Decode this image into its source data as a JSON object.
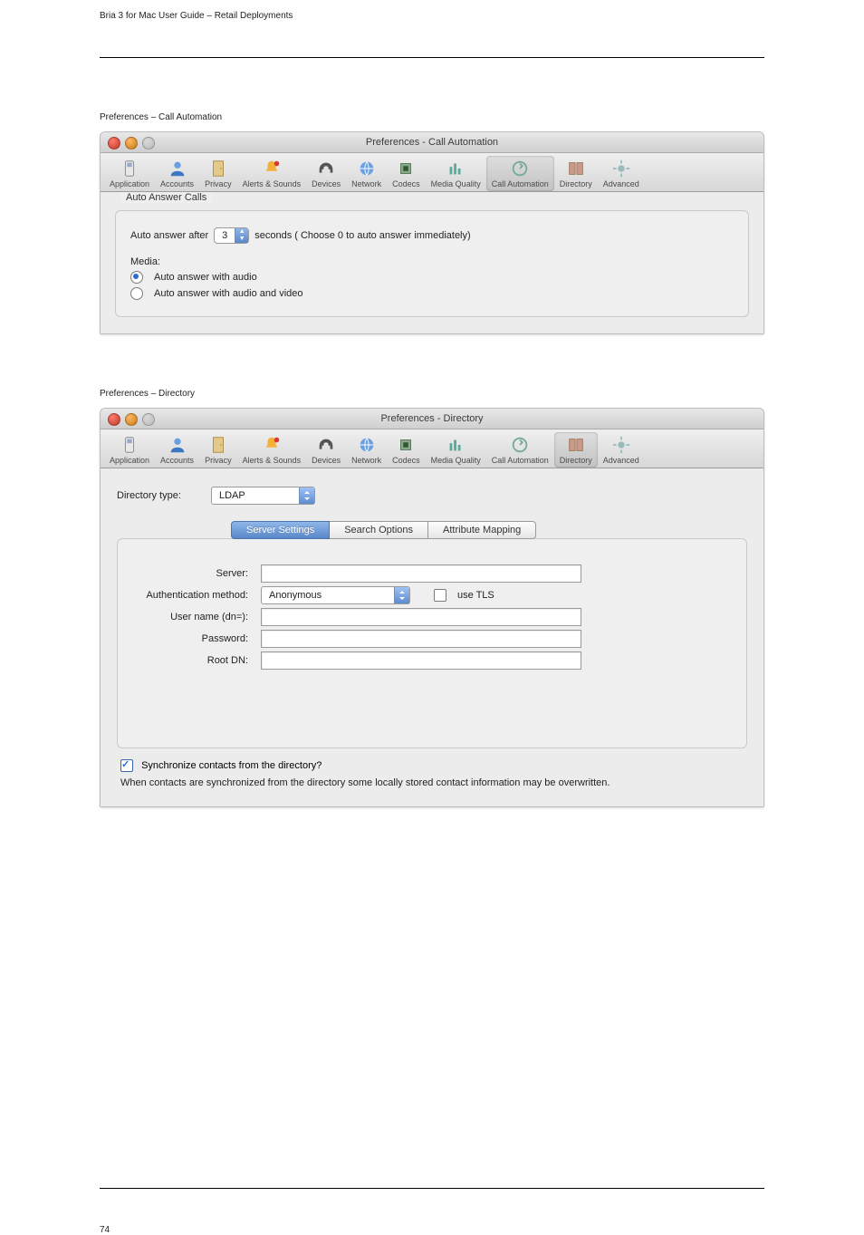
{
  "header": {
    "left": "Bria 3 for Mac User Guide – Retail Deployments"
  },
  "sections": {
    "call_automation_title": "Preferences – Call Automation",
    "directory_heading": "Preferences – Directory"
  },
  "toolbar": {
    "items": [
      {
        "label": "Application"
      },
      {
        "label": "Accounts"
      },
      {
        "label": "Privacy"
      },
      {
        "label": "Alerts & Sounds"
      },
      {
        "label": "Devices"
      },
      {
        "label": "Network"
      },
      {
        "label": "Codecs"
      },
      {
        "label": "Media Quality"
      },
      {
        "label": "Call Automation"
      },
      {
        "label": "Directory"
      },
      {
        "label": "Advanced"
      }
    ]
  },
  "panel1": {
    "title": "Preferences - Call Automation",
    "group_label": "Auto Answer Calls",
    "auto_answer_prefix": "Auto answer after",
    "auto_answer_value": "3",
    "auto_answer_suffix": "seconds ( Choose 0 to auto answer immediately)",
    "media_label": "Media:",
    "radio_audio": "Auto answer with audio",
    "radio_av": "Auto answer with audio and video"
  },
  "panel2": {
    "title": "Preferences - Directory",
    "dir_type_label": "Directory type:",
    "dir_type_value": "LDAP",
    "tabs": [
      "Server Settings",
      "Search Options",
      "Attribute Mapping"
    ],
    "fields": {
      "server_label": "Server:",
      "auth_label": "Authentication method:",
      "auth_value": "Anonymous",
      "use_tls": "use TLS",
      "user_label": "User name (dn=):",
      "pass_label": "Password:",
      "root_label": "Root DN:"
    },
    "sync_label": "Synchronize contacts from the directory?",
    "sync_help": "When contacts are synchronized from the directory some locally stored contact information may be overwritten."
  },
  "footer": {
    "page": "74"
  }
}
